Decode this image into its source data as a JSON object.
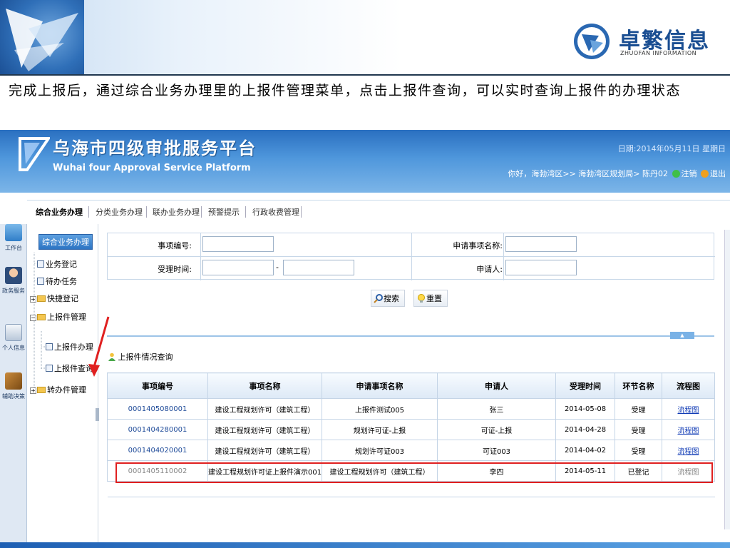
{
  "slide": {
    "brand_cn": "卓繁信息",
    "brand_en": "ZHUOFAN INFORMATION",
    "caption": "完成上报后，通过综合业务办理里的上报件管理菜单，点击上报件查询，可以实时查询上报件的办理状态"
  },
  "app": {
    "title_cn": "乌海市四级审批服务平台",
    "title_en": "Wuhai four Approval Service Platform",
    "date": "日期:2014年05月11日 星期日",
    "user_path": "你好，海勃湾区>> 海勃湾区规划局> 陈丹02",
    "logout": "注销",
    "exit": "退出"
  },
  "top_nav": [
    "综合业务办理",
    "分类业务办理",
    "联办业务办理",
    "预警提示",
    "行政收费管理"
  ],
  "left_rail": [
    "工作台",
    "政务服务",
    "个人信息",
    "辅助决策"
  ],
  "side_tree": {
    "title": "综合业务办理",
    "items": [
      "业务登记",
      "待办任务",
      "快捷登记",
      "上报件管理",
      "上报件办理",
      "上报件查询",
      "转办件管理"
    ]
  },
  "search": {
    "item_no_label": "事项编号:",
    "apply_name_label": "申请事项名称:",
    "accept_time_label": "受理时间:",
    "applicant_label": "申请人:",
    "dash": "-",
    "search_btn": "搜索",
    "reset_btn": "重置"
  },
  "results": {
    "title": "上报件情况查询",
    "toggle": "▲",
    "columns": [
      "事项编号",
      "事项名称",
      "申请事项名称",
      "申请人",
      "受理时间",
      "环节名称",
      "流程图"
    ],
    "rows": [
      [
        "0001405080001",
        "建设工程规划许可（建筑工程）",
        "上报件测试005",
        "张三",
        "2014-05-08",
        "受理",
        "流程图"
      ],
      [
        "0001404280001",
        "建设工程规划许可（建筑工程）",
        "规划许可证-上报",
        "可证-上报",
        "2014-04-28",
        "受理",
        "流程图"
      ],
      [
        "0001404020001",
        "建设工程规划许可（建筑工程）",
        "规划许可证003",
        "可证003",
        "2014-04-02",
        "受理",
        "流程图"
      ],
      [
        "0001405110002",
        "建设工程规划许可证上报件演示001",
        "建设工程规划许可（建筑工程）",
        "李四",
        "2014-05-11",
        "已登记",
        "流程图"
      ]
    ]
  },
  "colors": {
    "header_blue": "#2a6fc0",
    "highlight_red": "#e02020",
    "link_blue": "#0f3ab5"
  }
}
